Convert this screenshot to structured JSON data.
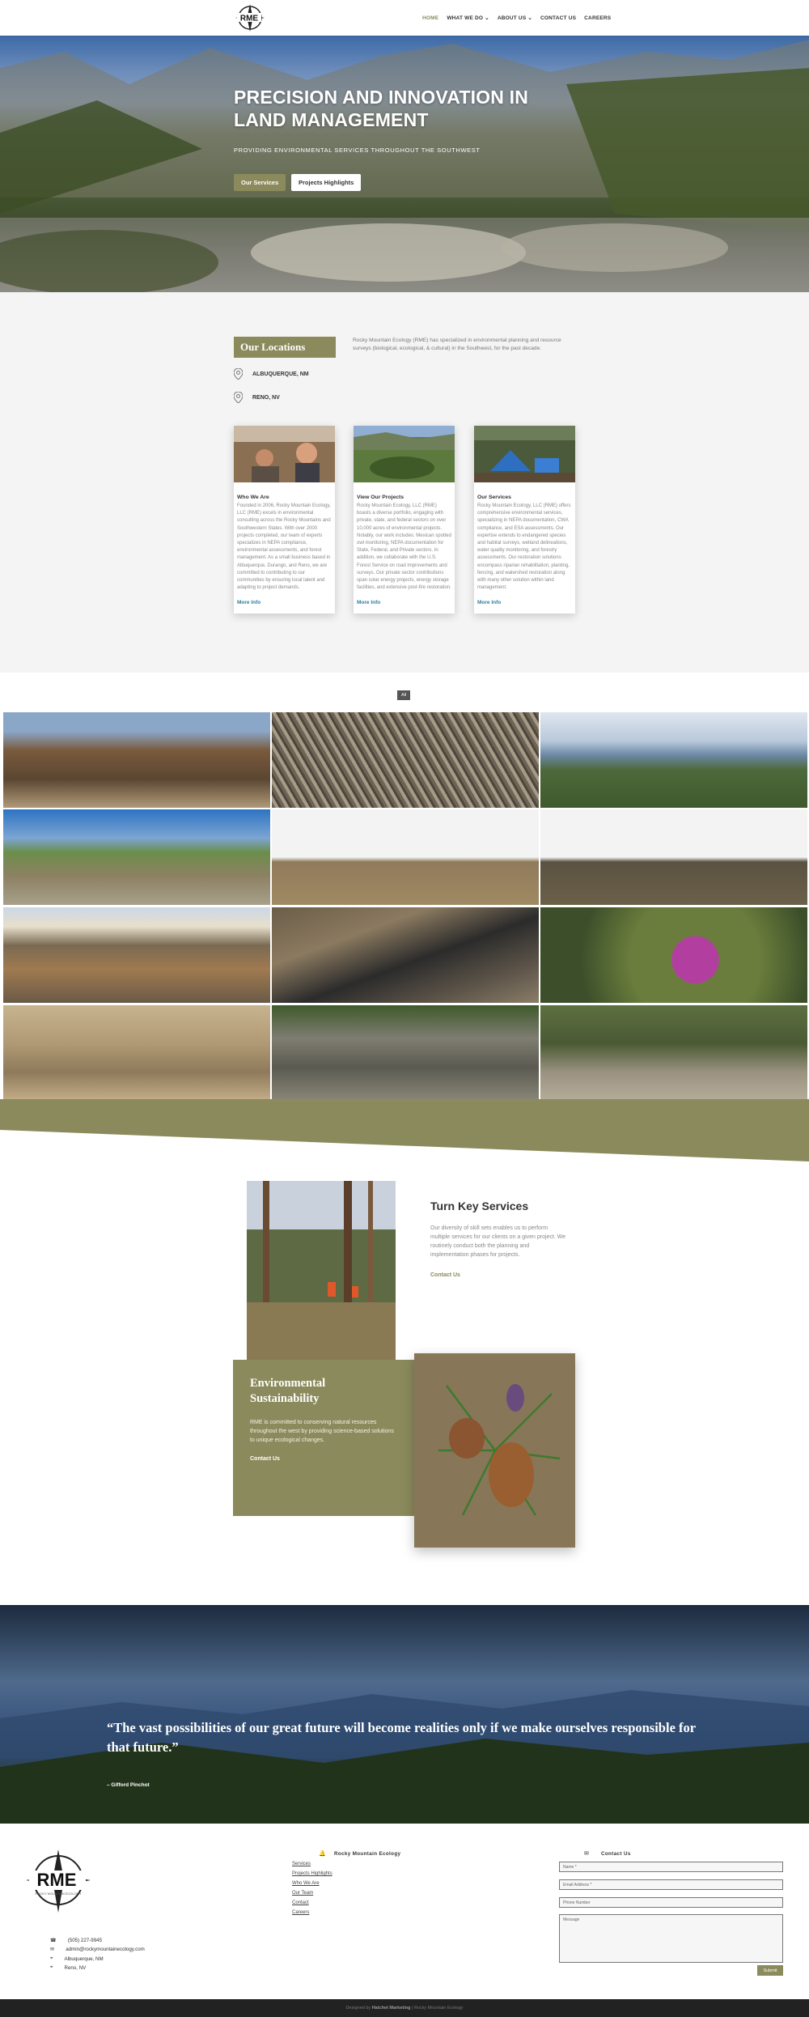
{
  "brand": {
    "logo_text": "RME",
    "logo_subtext": "ROCKY MOUNTAIN ECOLOGY",
    "accent": "#8b8a5c",
    "link_color": "#2c7fa1"
  },
  "nav": {
    "home": "HOME",
    "what_we_do": "WHAT WE DO",
    "about_us": "ABOUT US",
    "contact_us": "CONTACT US",
    "careers": "CAREERS"
  },
  "hero": {
    "title": "PRECISION AND INNOVATION IN LAND MANAGEMENT",
    "subtitle": "PROVIDING ENVIRONMENTAL SERVICES THROUGHOUT THE SOUTHWEST",
    "btn_services": "Our Services",
    "btn_projects": "Projects Highlights"
  },
  "locations": {
    "heading": "Our Locations",
    "intro": "Rocky Mountain Ecology (RME) has specialized in environmental planning and resource surveys (biological, ecological, & cultural) in the Southwest, for the past decade.",
    "items": [
      {
        "label": "ALBUQUERQUE, NM",
        "icon": "map-pin-icon"
      },
      {
        "label": "RENO, NV",
        "icon": "map-pin-icon"
      }
    ]
  },
  "cards": [
    {
      "title": "Who We Are",
      "body": "Founded in 2006, Rocky Mountain Ecology, LLC (RME) excels in environmental consulting across the Rocky Mountains and Southwestern States. With over 2000 projects completed, our team of experts specializes in NEPA compliance, environmental assessments, and forest management. As a small business based in Albuquerque, Durango, and Reno, we are committed to contributing to our communities by ensuring local talent and adapting to project demands.",
      "link": "More Info"
    },
    {
      "title": "View Our Projects",
      "body": "Rocky Mountain Ecology, LLC (RME) boasts a diverse portfolio, engaging with private, state, and federal sectors on over 10,000 acres of environmental projects. Notably, our work includes: Mexican spotted owl monitoring, NEPA documentation for State, Federal, and Private sectors. In addition, we collaborate with the U.S. Forest Service on road improvements and surveys. Our private sector contributions span solar energy projects, energy storage facilities, and extensive post-fire restoration.",
      "link": "More Info"
    },
    {
      "title": "Our Services",
      "body": "Rocky Mountain Ecology, LLC (RME) offers comprehensive environmental services, specializing in NEPA documentation, CWA compliance, and ESA assessments. Our expertise extends to endangered species and habitat surveys, wetland delineations, water quality monitoring, and forestry assessments. Our restoration solutions encompass riparian rehabilitation, planting, fencing, and watershed restoration along with many other solution within land management.",
      "link": "More Info"
    }
  ],
  "gallery": {
    "filter_all": "All"
  },
  "turnkey": {
    "title": "Turn Key Services",
    "body": "Our diversity of skill sets enables us to perform multiple services for our clients on a given project. We routinely conduct both the planning and implementation phases for projects.",
    "link": "Contact Us"
  },
  "sustainability": {
    "title": "Environmental Sustainability",
    "body": "RME is committed to conserving natural resources throughout the west by providing science-based solutions to unique ecological changes.",
    "link": "Contact Us"
  },
  "quote": {
    "text": "“The vast possibilities of our great future will become realities only if we make ourselves responsible for that future.”",
    "author": "– Gifford Pinchot"
  },
  "footer": {
    "contacts": [
      {
        "icon": "phone-icon",
        "text": "(505) 227-9945"
      },
      {
        "icon": "envelope-icon",
        "text": "admin@rockymountainecology.com"
      },
      {
        "icon": "map-pin-icon",
        "text": "Albuquerque, NM"
      },
      {
        "icon": "map-pin-icon",
        "text": "Reno, NV"
      }
    ],
    "middle_title": "Rocky Mountain Ecology",
    "links": [
      "Services",
      "Projects Highlights",
      "Who We Are",
      "Our Team",
      "Contact",
      "Careers"
    ],
    "right_title": "Contact Us",
    "form": {
      "name_placeholder": "Name *",
      "email_placeholder": "Email Address *",
      "phone_placeholder": "Phone Number",
      "message_placeholder": "Message",
      "submit": "Submit"
    },
    "credit_prefix": "Designed by",
    "credit_agency": "Hatchet Marketing",
    "credit_suffix": "| Rocky Mountain Ecology"
  }
}
